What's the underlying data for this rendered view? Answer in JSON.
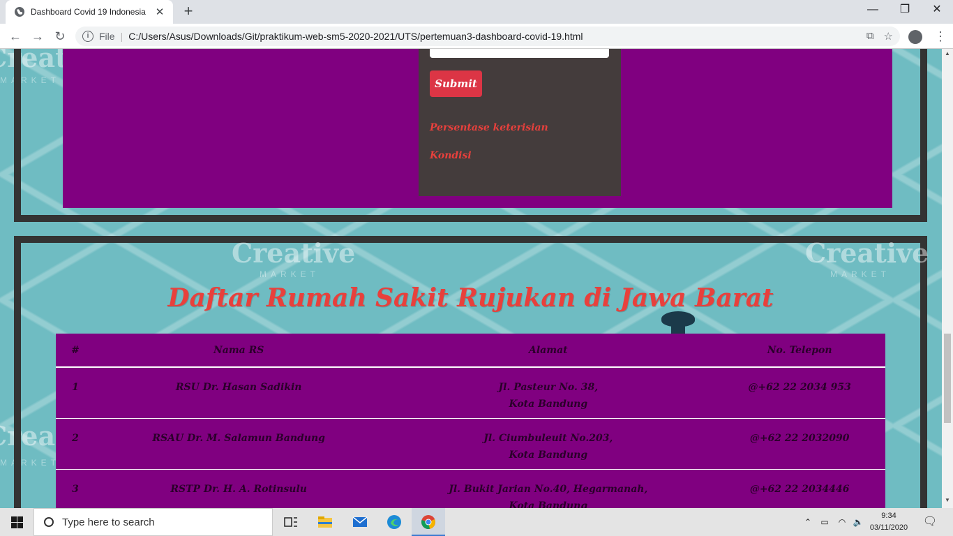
{
  "browser": {
    "tab_title": "Dashboard Covid 19 Indonesia",
    "tab_close": "✕",
    "new_tab": "+",
    "window_minimize": "—",
    "window_maximize": "❐",
    "window_close": "✕",
    "address_scheme_label": "File",
    "address_url": "C:/Users/Asus/Downloads/Git/praktikum-web-sm5-2020-2021/UTS/pertemuan3-dashboard-covid-19.html"
  },
  "form": {
    "submit_label": "Submit",
    "link_persentase": "Persentase keterisian",
    "link_kondisi": "Kondisi"
  },
  "watermark": {
    "brand": "Creative",
    "sub": "MARKET"
  },
  "hospitals": {
    "title": "Daftar Rumah Sakit Rujukan di Jawa Barat",
    "columns": [
      "#",
      "Nama RS",
      "Alamat",
      "No. Telepon"
    ],
    "rows": [
      {
        "no": "1",
        "name": "RSU Dr. Hasan Sadikin",
        "address_line1": "Jl. Pasteur No. 38,",
        "address_line2": "Kota Bandung",
        "phone": "@+62 22 2034 953"
      },
      {
        "no": "2",
        "name": "RSAU Dr. M. Salamun Bandung",
        "address_line1": "Jl. Ciumbuleuit No.203,",
        "address_line2": "Kota Bandung",
        "phone": "@+62 22 2032090"
      },
      {
        "no": "3",
        "name": "RSTP Dr. H. A. Rotinsulu",
        "address_line1": "Jl. Bukit Jarian No.40, Hegarmanah,",
        "address_line2": "Kota Bandung",
        "phone": "@+62 22 2034446"
      }
    ]
  },
  "taskbar": {
    "search_placeholder": "Type here to search",
    "time": "9:34",
    "date": "03/11/2020"
  },
  "colors": {
    "accent_red": "#e8403c",
    "panel_purple": "#800080",
    "card_dark": "#443c3c",
    "button_red": "#dc3545",
    "page_bg": "#6fbcc2"
  }
}
